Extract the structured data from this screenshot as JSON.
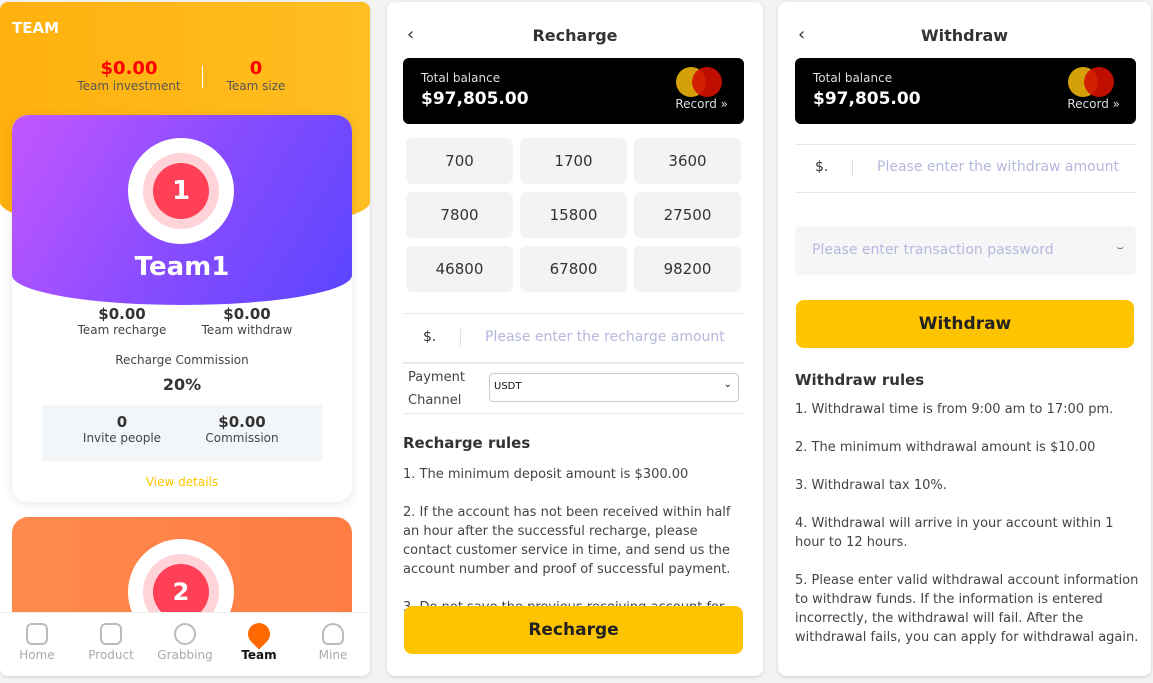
{
  "team": {
    "header": "TEAM",
    "investment_value": "$0.00",
    "investment_label": "Team investment",
    "size_value": "0",
    "size_label": "Team size",
    "card1": {
      "rank": "1",
      "name": "Team1",
      "recharge_value": "$0.00",
      "recharge_label": "Team recharge",
      "withdraw_value": "$0.00",
      "withdraw_label": "Team withdraw",
      "commission_rate_label": "Recharge Commission",
      "commission_rate": "20%",
      "invite_value": "0",
      "invite_label": "Invite people",
      "commission_value": "$0.00",
      "commission_label": "Commission",
      "details_link": "View details"
    },
    "card2": {
      "rank": "2"
    },
    "nav": [
      {
        "label": "Home",
        "icon": "home-icon"
      },
      {
        "label": "Product",
        "icon": "box-icon"
      },
      {
        "label": "Grabbing",
        "icon": "chart-icon"
      },
      {
        "label": "Team",
        "icon": "team-heart-icon",
        "active": true
      },
      {
        "label": "Mine",
        "icon": "user-icon"
      }
    ]
  },
  "recharge": {
    "title": "Recharge",
    "balance_label": "Total balance",
    "balance": "$97,805.00",
    "record": "Record »",
    "amounts": [
      "700",
      "1700",
      "3600",
      "7800",
      "15800",
      "27500",
      "46800",
      "67800",
      "98200"
    ],
    "currency": "$.",
    "amount_placeholder": "Please enter the recharge amount",
    "channel_label_1": "Payment",
    "channel_label_2": "Channel",
    "channel_value": "USDT",
    "rules_title": "Recharge rules",
    "rules": [
      "1. The minimum deposit amount is $300.00",
      "2. If the account has not been received within half an hour after the successful recharge, please contact customer service in time, and send us the account number and proof of successful payment.",
      "3. Do not save the previous receiving account for"
    ],
    "button": "Recharge"
  },
  "withdraw": {
    "title": "Withdraw",
    "balance_label": "Total balance",
    "balance": "$97,805.00",
    "record": "Record »",
    "currency": "$.",
    "amount_placeholder": "Please enter the withdraw amount",
    "password_placeholder": "Please enter transaction password",
    "button": "Withdraw",
    "rules_title": "Withdraw rules",
    "rules": [
      "1. Withdrawal time is from 9:00 am to 17:00 pm.",
      "2. The minimum withdrawal amount is $10.00",
      "3. Withdrawal tax 10%.",
      "4. Withdrawal will arrive in your account within 1 hour to 12 hours.",
      "5. Please enter valid withdrawal account information to withdraw funds. If the information is entered incorrectly, the withdrawal will fail. After the withdrawal fails, you can apply for withdrawal again."
    ]
  },
  "colors": {
    "accent": "#ffc400",
    "header": "#ffb10e",
    "value_red": "#ff0000",
    "purple": "#8a4cff",
    "orange_card": "#ff8a4c"
  }
}
